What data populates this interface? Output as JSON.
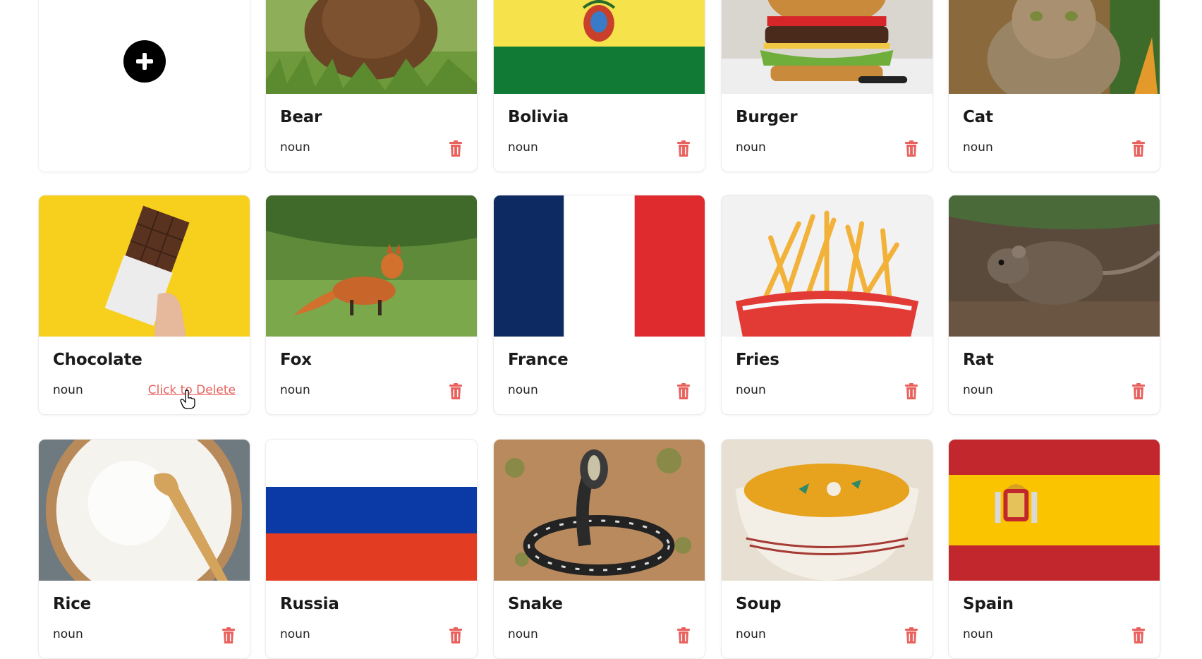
{
  "add_card": {
    "icon": "plus-circle-icon"
  },
  "accent_delete_color": "#e8615d",
  "hover_card": {
    "delete_label": "Click to Delete"
  },
  "cards": [
    {
      "title": "Bear",
      "pos": "noun",
      "image": "bear-photo"
    },
    {
      "title": "Bolivia",
      "pos": "noun",
      "image": "bolivia-flag"
    },
    {
      "title": "Burger",
      "pos": "noun",
      "image": "burger-photo"
    },
    {
      "title": "Cat",
      "pos": "noun",
      "image": "cat-photo"
    },
    {
      "title": "Chocolate",
      "pos": "noun",
      "image": "chocolate-photo"
    },
    {
      "title": "Fox",
      "pos": "noun",
      "image": "fox-photo"
    },
    {
      "title": "France",
      "pos": "noun",
      "image": "france-flag"
    },
    {
      "title": "Fries",
      "pos": "noun",
      "image": "fries-photo"
    },
    {
      "title": "Rat",
      "pos": "noun",
      "image": "rat-photo"
    },
    {
      "title": "Rice",
      "pos": "noun",
      "image": "rice-photo"
    },
    {
      "title": "Russia",
      "pos": "noun",
      "image": "russia-flag"
    },
    {
      "title": "Snake",
      "pos": "noun",
      "image": "snake-photo"
    },
    {
      "title": "Soup",
      "pos": "noun",
      "image": "soup-photo"
    },
    {
      "title": "Spain",
      "pos": "noun",
      "image": "spain-flag"
    }
  ]
}
